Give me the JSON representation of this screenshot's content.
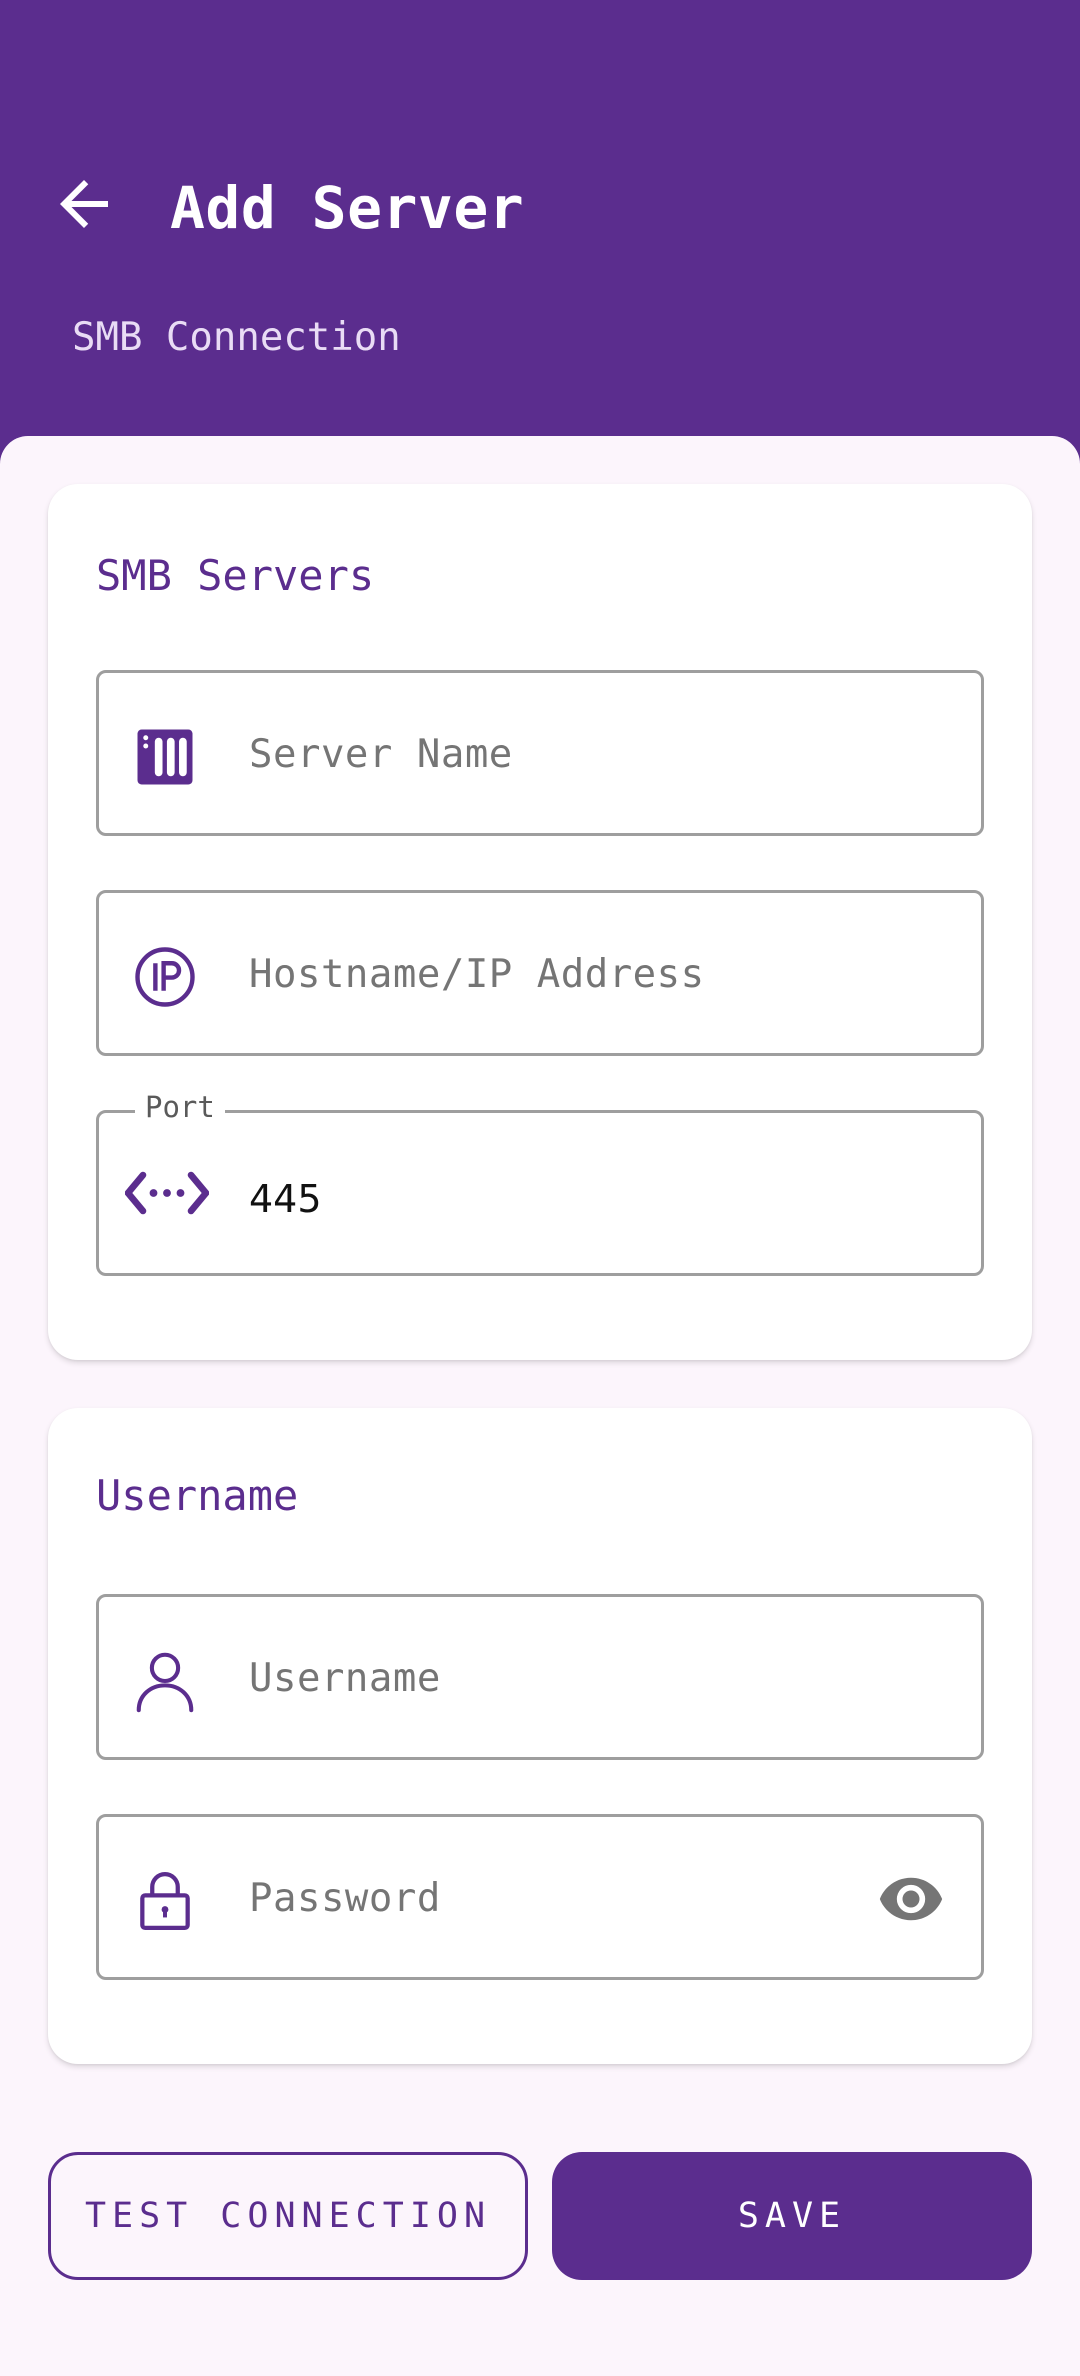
{
  "colors": {
    "primary": "#5b2d8e",
    "background": "#fcf5fc",
    "card": "#ffffff"
  },
  "header": {
    "back_icon": "arrow-left-icon",
    "title": "Add Server",
    "subtitle": "SMB Connection"
  },
  "server_card": {
    "title": "SMB Servers",
    "server_name": {
      "icon": "server-icon",
      "placeholder": "Server Name",
      "value": ""
    },
    "hostname": {
      "icon": "ip-icon",
      "placeholder": "Hostname/IP Address",
      "value": ""
    },
    "port": {
      "icon": "port-icon",
      "label": "Port",
      "value": "445"
    }
  },
  "credentials_card": {
    "title": "Username",
    "username": {
      "icon": "user-icon",
      "placeholder": "Username",
      "value": ""
    },
    "password": {
      "icon": "lock-icon",
      "placeholder": "Password",
      "value": "",
      "toggle_icon": "eye-icon"
    }
  },
  "actions": {
    "test_label": "TEST CONNECTION",
    "save_label": "SAVE"
  }
}
